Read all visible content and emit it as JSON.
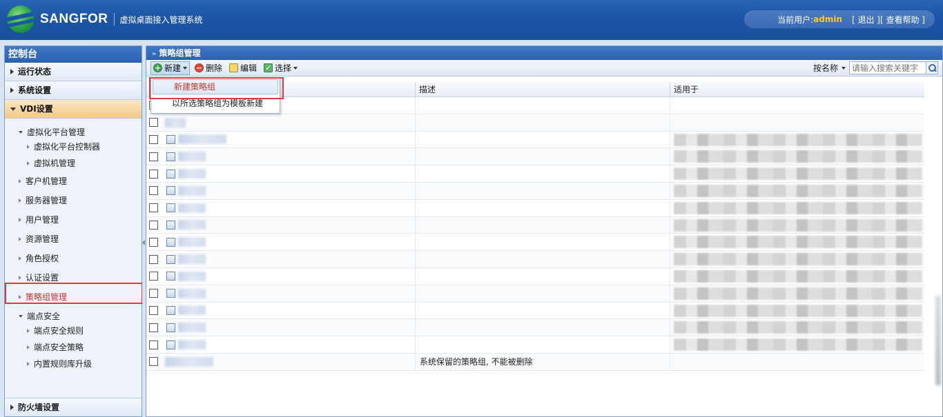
{
  "header": {
    "brand": "SANGFOR",
    "subtitle": "虚拟桌面接入管理系统",
    "user_label": "当前用户:",
    "username": "admin",
    "logout": "[ 退出 ]",
    "help": "[ 查看帮助 ]"
  },
  "sidebar": {
    "title": "控制台",
    "sections": {
      "running": "运行状态",
      "system": "系统设置",
      "vdi": "VDI设置",
      "firewall": "防火墙设置"
    },
    "tree": {
      "virt_platform": "虚拟化平台管理",
      "virt_controller": "虚拟化平台控制器",
      "vm_manage": "虚拟机管理",
      "client_manage": "客户机管理",
      "server_manage": "服务器管理",
      "user_manage": "用户管理",
      "resource_manage": "资源管理",
      "role_auth": "角色授权",
      "auth_settings": "认证设置",
      "policy_group": "策略组管理",
      "endpoint_security": "端点安全",
      "endpoint_rules": "端点安全规则",
      "endpoint_policy": "端点安全策略",
      "builtin_rule_upgrade": "内置规则库升级"
    }
  },
  "main": {
    "panel_title": "策略组管理",
    "toolbar": {
      "new": "新建",
      "delete": "删除",
      "edit": "编辑",
      "select": "选择",
      "search_by": "按名称",
      "search_placeholder": "请输入搜索关键字"
    },
    "columns": {
      "desc": "描述",
      "apply": "适用于"
    },
    "menu": {
      "new_group": "新建策略组",
      "new_from_template": "以所选策略组为模板新建"
    },
    "rows": [
      {
        "desc": ""
      },
      {
        "desc": ""
      },
      {
        "desc": ""
      },
      {
        "desc": ""
      },
      {
        "desc": ""
      },
      {
        "desc": ""
      },
      {
        "desc": ""
      },
      {
        "desc": ""
      },
      {
        "desc": ""
      },
      {
        "desc": ""
      },
      {
        "desc": ""
      },
      {
        "desc": ""
      },
      {
        "desc": ""
      },
      {
        "desc": ""
      },
      {
        "desc": ""
      },
      {
        "desc": "系统保留的策略组, 不能被删除"
      }
    ]
  },
  "colors": {
    "header_blue": "#1d55a6",
    "username_gold": "#ffc82a",
    "highlight_red": "#e0393e",
    "active_section": "#f4c98a"
  },
  "icons": [
    "logo-globe-icon",
    "add-icon",
    "delete-icon",
    "edit-icon",
    "check-icon",
    "search-icon",
    "policy-group-icon"
  ]
}
